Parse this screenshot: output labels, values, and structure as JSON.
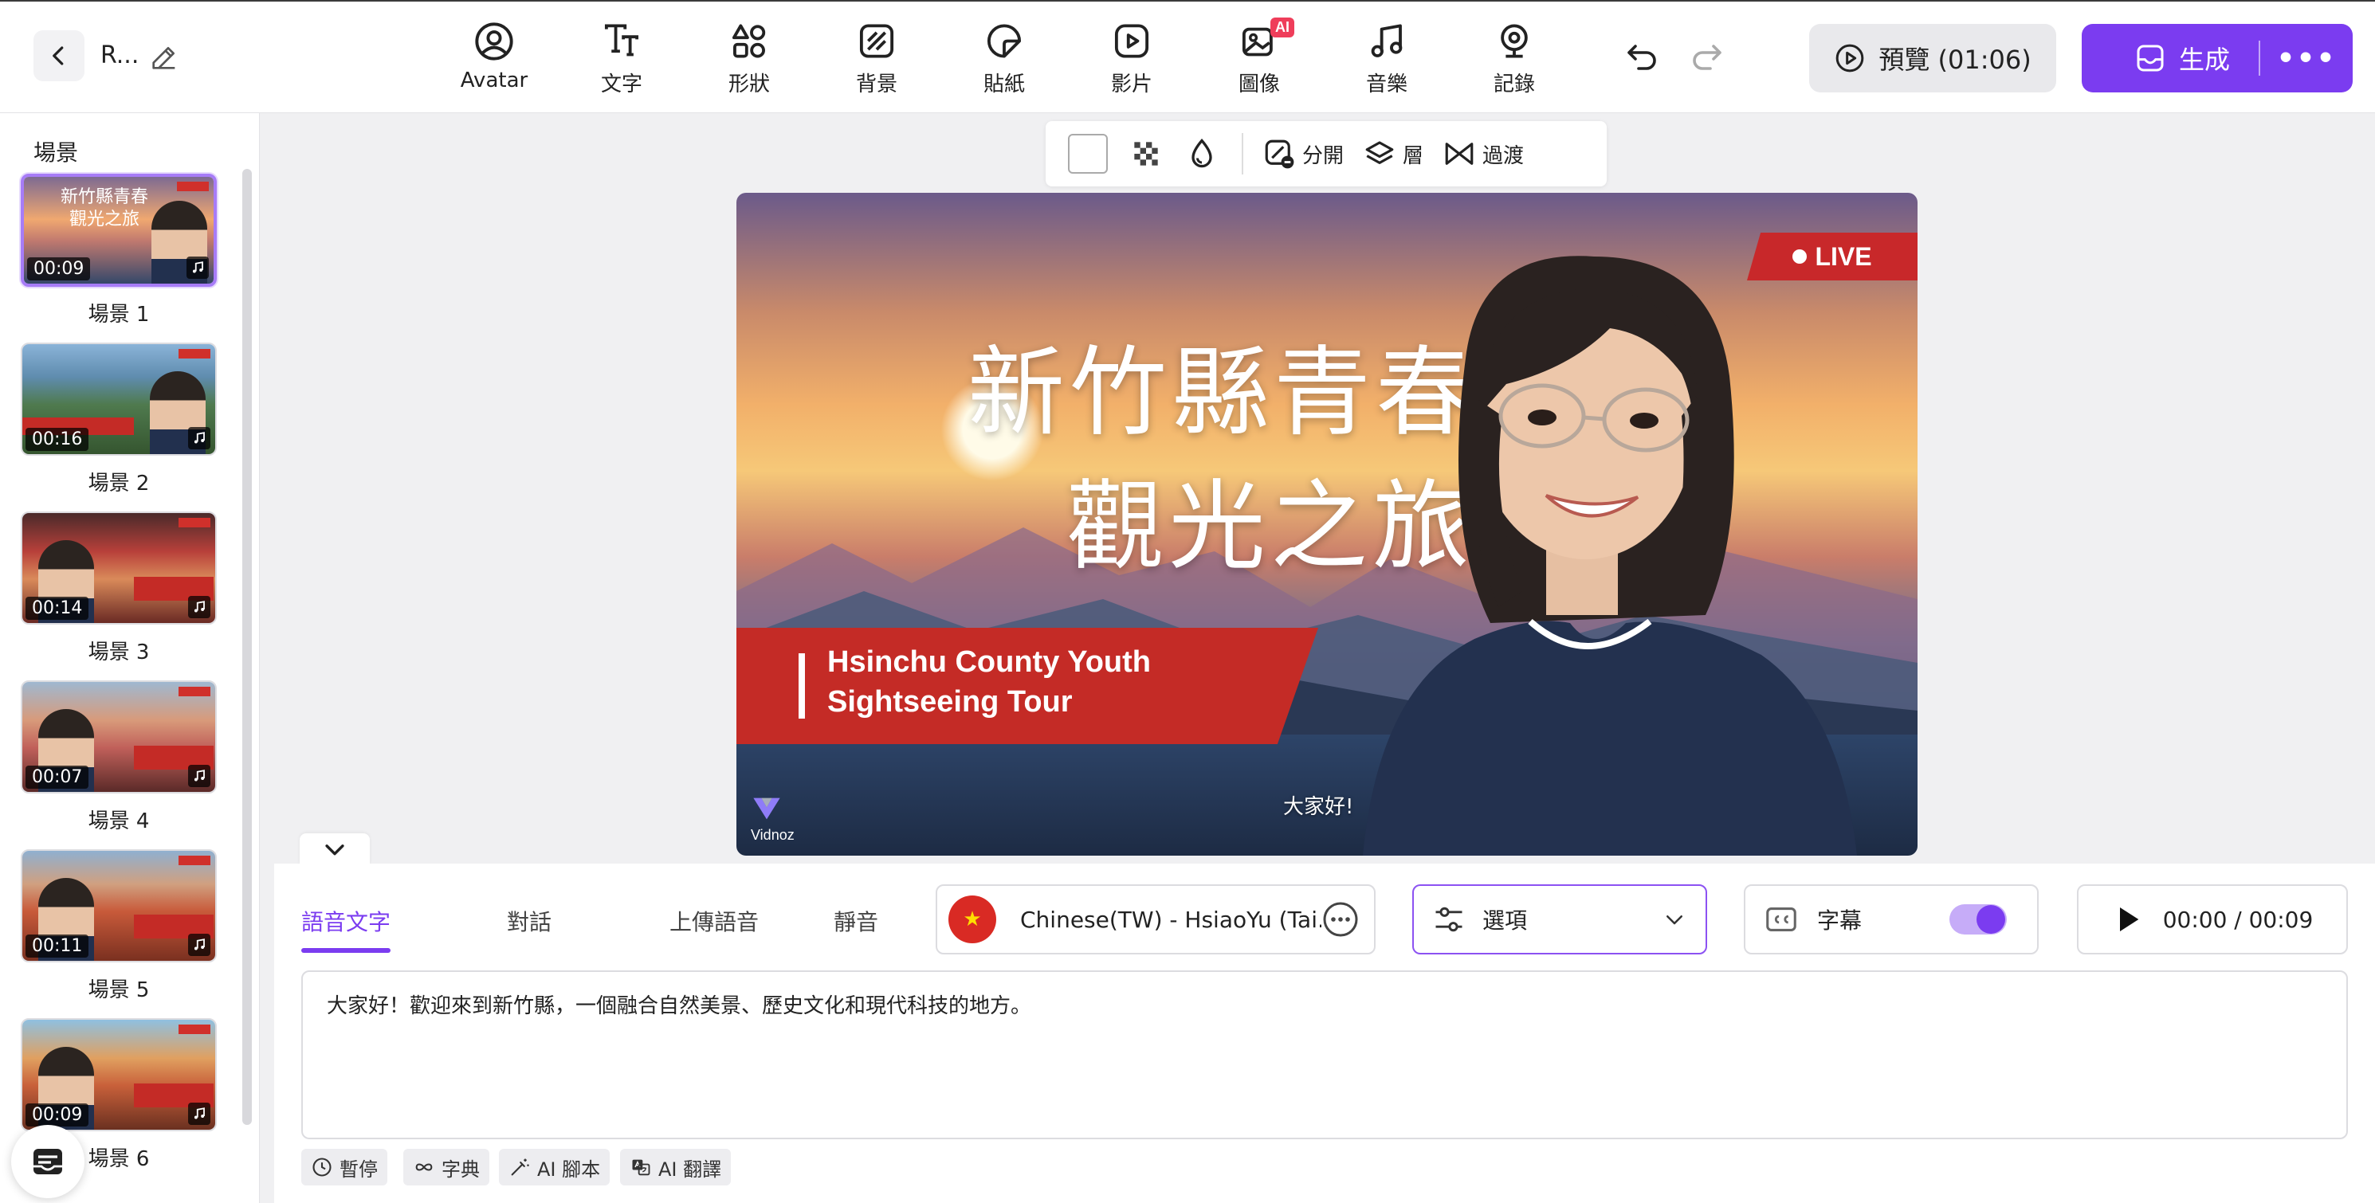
{
  "header": {
    "project_name": "R...",
    "tools": [
      {
        "label": "Avatar",
        "icon": "avatar-icon"
      },
      {
        "label": "文字",
        "icon": "text-icon"
      },
      {
        "label": "形狀",
        "icon": "shape-icon"
      },
      {
        "label": "背景",
        "icon": "background-icon"
      },
      {
        "label": "貼紙",
        "icon": "sticker-icon"
      },
      {
        "label": "影片",
        "icon": "video-icon"
      },
      {
        "label": "圖像",
        "icon": "image-icon",
        "badge": "AI"
      },
      {
        "label": "音樂",
        "icon": "music-icon"
      },
      {
        "label": "記錄",
        "icon": "record-icon"
      }
    ],
    "preview_label": "預覽 (01:06)",
    "generate_label": "生成",
    "more_label": "•••"
  },
  "sidebar": {
    "title": "場景",
    "scenes": [
      {
        "label": "場景 1",
        "duration": "00:09",
        "thumb_title_1": "新竹縣青春",
        "thumb_title_2": "觀光之旅"
      },
      {
        "label": "場景 2",
        "duration": "00:16"
      },
      {
        "label": "場景 3",
        "duration": "00:14"
      },
      {
        "label": "場景 4",
        "duration": "00:07"
      },
      {
        "label": "場景 5",
        "duration": "00:11"
      },
      {
        "label": "場景 6",
        "duration": "00:09"
      }
    ]
  },
  "canvas_toolbar": {
    "split_label": "分開",
    "layer_label": "層",
    "transition_label": "過渡"
  },
  "stage": {
    "live_label": "LIVE",
    "title_line1": "新竹縣青春",
    "title_line2": "觀光之旅",
    "banner_line1": "Hsinchu County Youth",
    "banner_line2": "Sightseeing Tour",
    "logo_text": "Vidnoz",
    "subtitle": "大家好!"
  },
  "panel": {
    "tabs": [
      "語音文字",
      "對話",
      "上傳語音",
      "靜音"
    ],
    "voice": "Chinese(TW) - HsiaoYu (Tai...",
    "options_label": "選項",
    "caption_label": "字幕",
    "caption_on": true,
    "playback": "00:00 / 00:09",
    "script_text": "大家好！歡迎來到新竹縣，一個融合自然美景、歷史文化和現代科技的地方。",
    "chips": [
      "暫停",
      "字典",
      "AI 腳本",
      "AI 翻譯"
    ]
  },
  "colors": {
    "accent": "#7b3cf0",
    "live_red": "#c8282a",
    "banner_red": "#c42b26"
  }
}
